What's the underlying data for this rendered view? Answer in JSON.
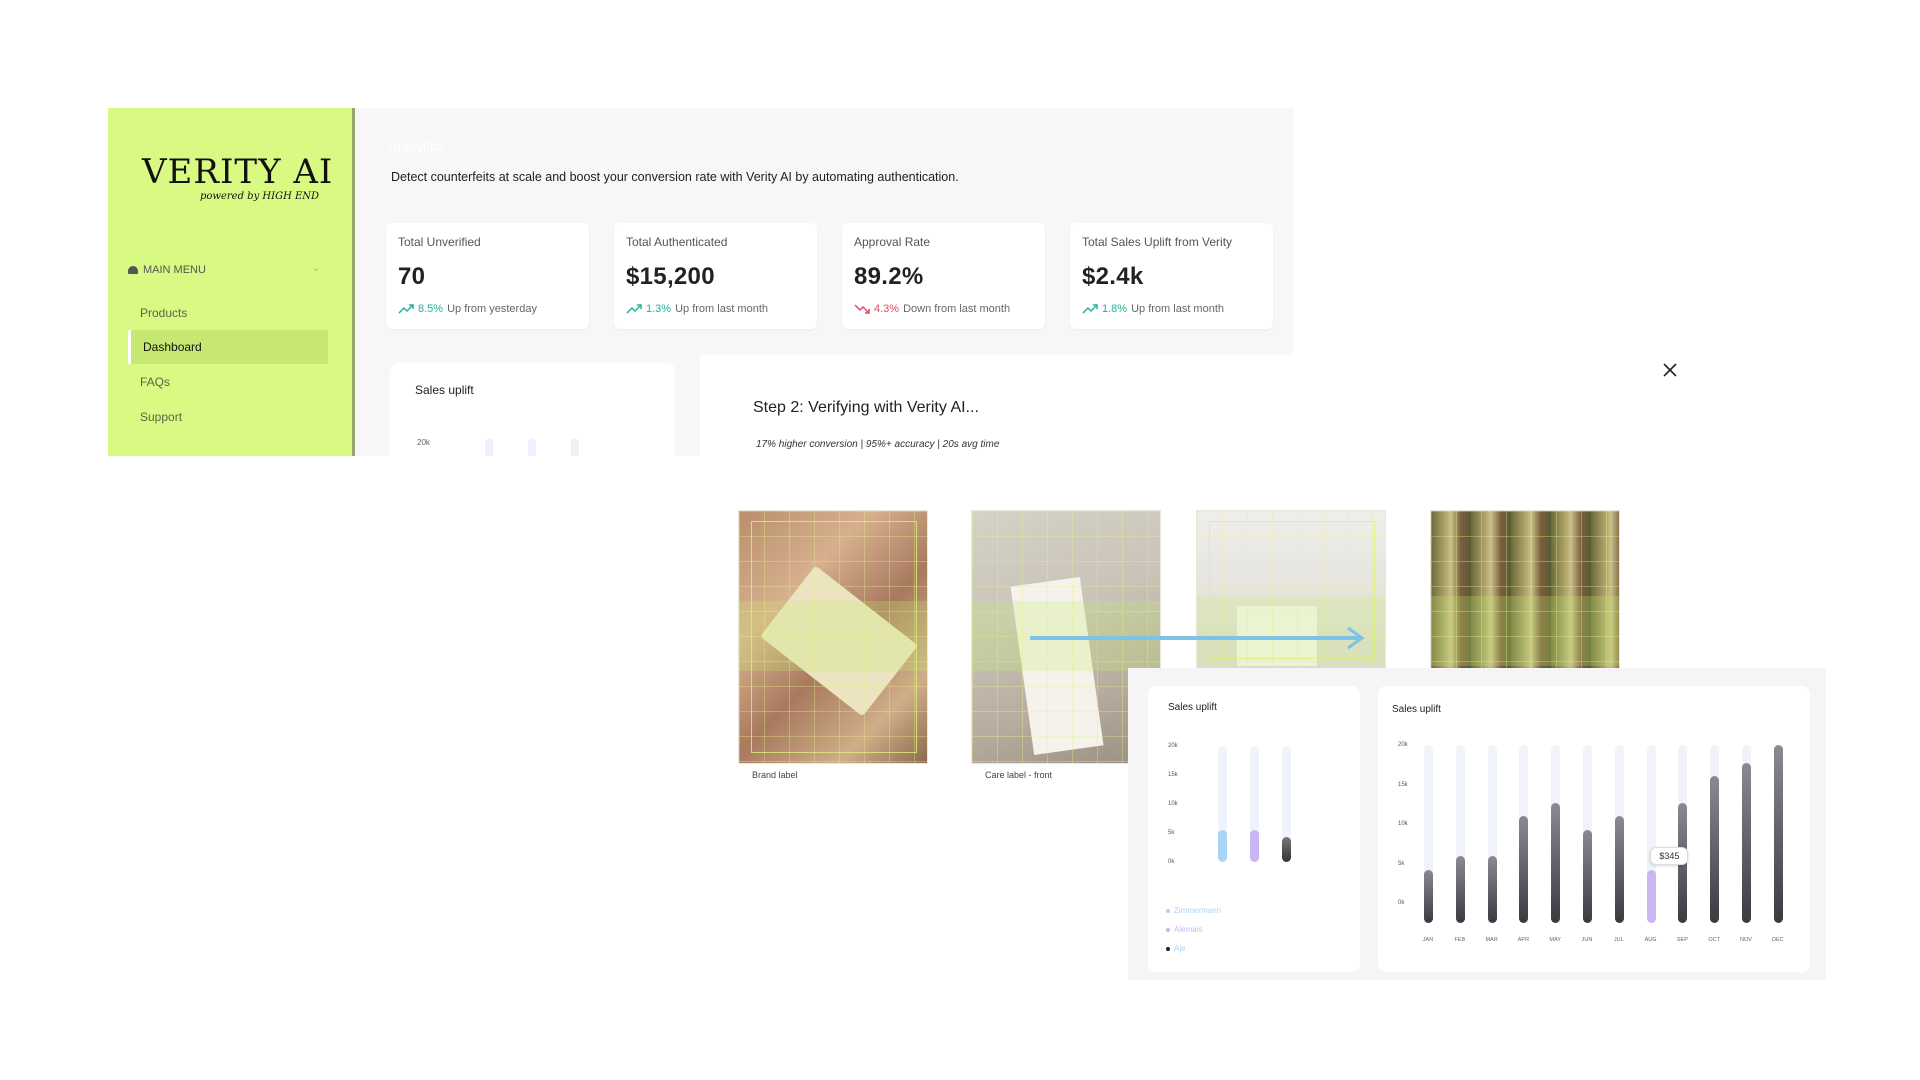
{
  "sidebar": {
    "logo": "VERITY AI",
    "logo_sub": "powered by HIGH END",
    "menu_heading": "MAIN MENU",
    "items": [
      {
        "label": "Products",
        "active": false
      },
      {
        "label": "Dashboard",
        "active": true
      },
      {
        "label": "FAQs",
        "active": false
      },
      {
        "label": "Support",
        "active": false
      }
    ]
  },
  "main": {
    "heading": "Analytics",
    "subtitle": "Detect counterfeits at scale and boost your conversion rate with Verity AI by automating authentication.",
    "cards": [
      {
        "label": "Total Unverified",
        "value": "70",
        "pct": "8.5%",
        "trend_text": "Up from yesterday",
        "direction": "up"
      },
      {
        "label": "Total Authenticated",
        "value": "$15,200",
        "pct": "1.3%",
        "trend_text": "Up from last month",
        "direction": "up"
      },
      {
        "label": "Approval Rate",
        "value": "89.2%",
        "pct": "4.3%",
        "trend_text": "Down from last month",
        "direction": "down"
      },
      {
        "label": "Total Sales Uplift from Verity",
        "value": "$2.4k",
        "pct": "1.8%",
        "trend_text": "Up from last month",
        "direction": "up"
      }
    ],
    "bg_chart": {
      "title": "Sales uplift",
      "ytick": "20k"
    }
  },
  "modal": {
    "step_title": "Step 2: Verifying with Verity AI...",
    "step_subtitle": "17% higher conversion | 95%+ accuracy | 20s avg time",
    "photos": [
      {
        "caption": "Brand label",
        "icon": "brand-label-photo"
      },
      {
        "caption": "Care label - front",
        "icon": "care-label-photo"
      },
      {
        "caption": "",
        "icon": "care-label-back-photo"
      },
      {
        "caption": "",
        "icon": "fabric-print-photo"
      }
    ]
  },
  "colors": {
    "sidebar_bg": "#d8f982",
    "up": "#22b29a",
    "down": "#e5485f",
    "arrow": "#7cc3e6",
    "zimmermann": "#a8d4f5",
    "alemais": "#c9b4f5",
    "aje": "#222222"
  },
  "chart_data": [
    {
      "type": "bar",
      "title": "Sales uplift",
      "y_ticks": [
        "20k",
        "15k",
        "10k",
        "5k",
        "0k"
      ],
      "ylim": [
        0,
        20000
      ],
      "series": [
        {
          "name": "Zimmermann",
          "color": "#a8d4f5",
          "values": [
            5500
          ]
        },
        {
          "name": "Alemais",
          "color": "#c9b4f5",
          "values": [
            5500
          ]
        },
        {
          "name": "Aje",
          "color": "#222222",
          "values": [
            4300
          ]
        }
      ],
      "legend": "bottom-left"
    },
    {
      "type": "bar",
      "title": "Sales uplift",
      "categories": [
        "JAN",
        "FEB",
        "MAR",
        "APR",
        "MAY",
        "JUN",
        "JUL",
        "AUG",
        "SEP",
        "OCT",
        "NOV",
        "DEC"
      ],
      "values": [
        6000,
        7500,
        7500,
        12000,
        13500,
        10500,
        12000,
        6000,
        13500,
        16500,
        18000,
        20000
      ],
      "y_ticks": [
        "20k",
        "15k",
        "10k",
        "5k",
        "0k"
      ],
      "ylim": [
        0,
        20000
      ],
      "highlight_index": 7,
      "tooltip": "$345"
    }
  ]
}
